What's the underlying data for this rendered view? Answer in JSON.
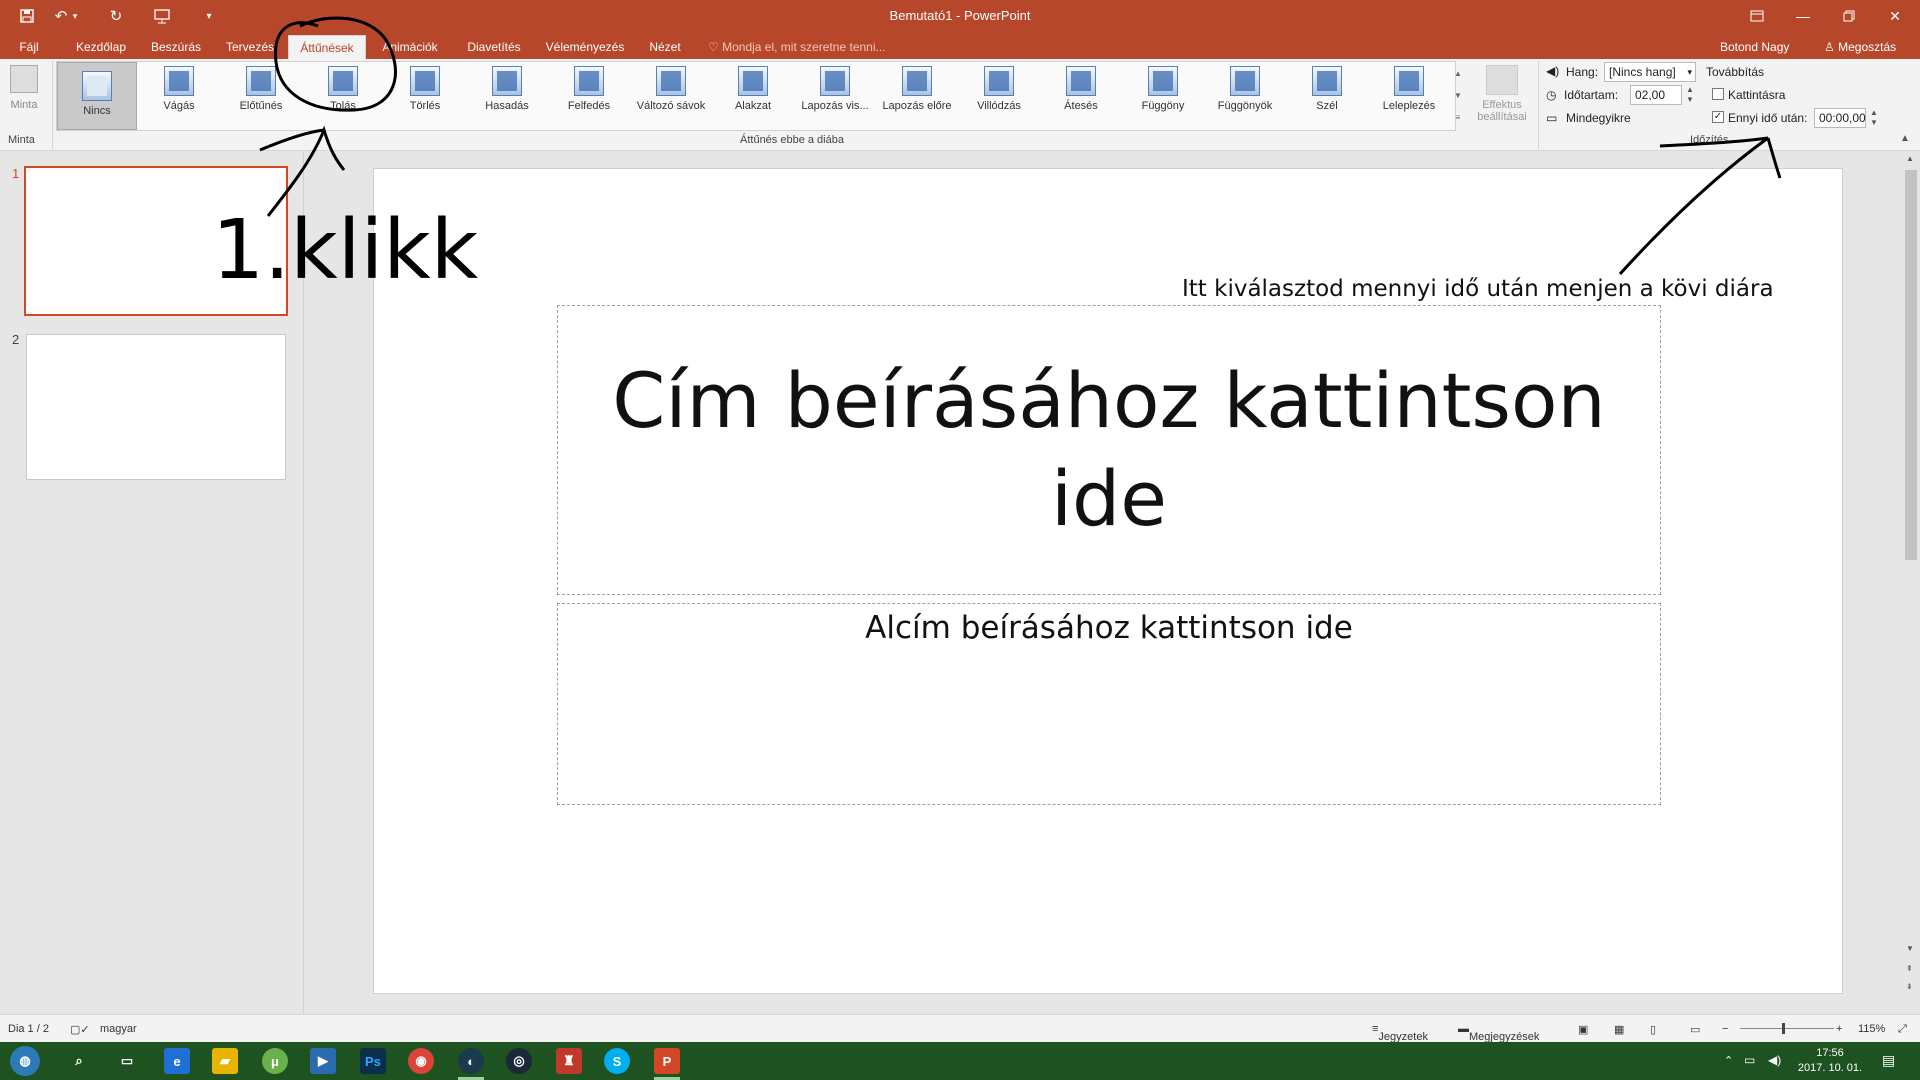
{
  "window": {
    "title": "Bemutató1 - PowerPoint",
    "user": "Botond Nagy",
    "share": "Megosztás"
  },
  "tabs": [
    "Fájl",
    "Kezdőlap",
    "Beszúrás",
    "Tervezés",
    "Áttűnések",
    "Animációk",
    "Diavetítés",
    "Véleményezés",
    "Nézet"
  ],
  "active_tab": "Áttűnések",
  "tell_me": "Mondja el, mit szeretne tenni...",
  "ribbon": {
    "preview": {
      "label": "Minta",
      "group": "Minta"
    },
    "gallery_group": "Áttűnés ebbe a diába",
    "transitions": [
      "Nincs",
      "Vágás",
      "Előtűnés",
      "Tolás",
      "Törlés",
      "Hasadás",
      "Felfedés",
      "Változó sávok",
      "Alakzat",
      "Lapozás vis...",
      "Lapozás előre",
      "Villódzás",
      "Átesés",
      "Függöny",
      "Függönyök",
      "Szél",
      "Leleplezés"
    ],
    "selected_transition": "Nincs",
    "effect_options": {
      "line1": "Effektus",
      "line2": "beállításai"
    },
    "timing": {
      "group": "Időzítés",
      "sound_label": "Hang:",
      "sound_value": "[Nincs hang]",
      "duration_label": "Időtartam:",
      "duration_value": "02,00",
      "apply_all": "Mindegyikre",
      "advance_title": "Továbbítás",
      "on_click": "Kattintásra",
      "on_click_checked": false,
      "after_label": "Ennyi idő után:",
      "after_checked": true,
      "after_value": "00:00,00"
    }
  },
  "slides_pane": {
    "numbers": [
      "1",
      "2"
    ],
    "selected": "1"
  },
  "slide": {
    "title": "Cím beírásához kattintson ide",
    "subtitle": "Alcím beírásához kattintson ide"
  },
  "annotations": {
    "click_text": "1.klikk",
    "time_note": "Itt kiválasztod mennyi idő után menjen a kövi diára"
  },
  "status": {
    "slide_of": "Dia 1 / 2",
    "language": "magyar",
    "notes": "Jegyzetek",
    "comments": "Megjegyzések",
    "zoom": "115%"
  },
  "taskbar": {
    "time": "17:56",
    "date": "2017. 10. 01."
  },
  "colors": {
    "accent": "#b7472a",
    "taskbar": "#1e5220"
  }
}
